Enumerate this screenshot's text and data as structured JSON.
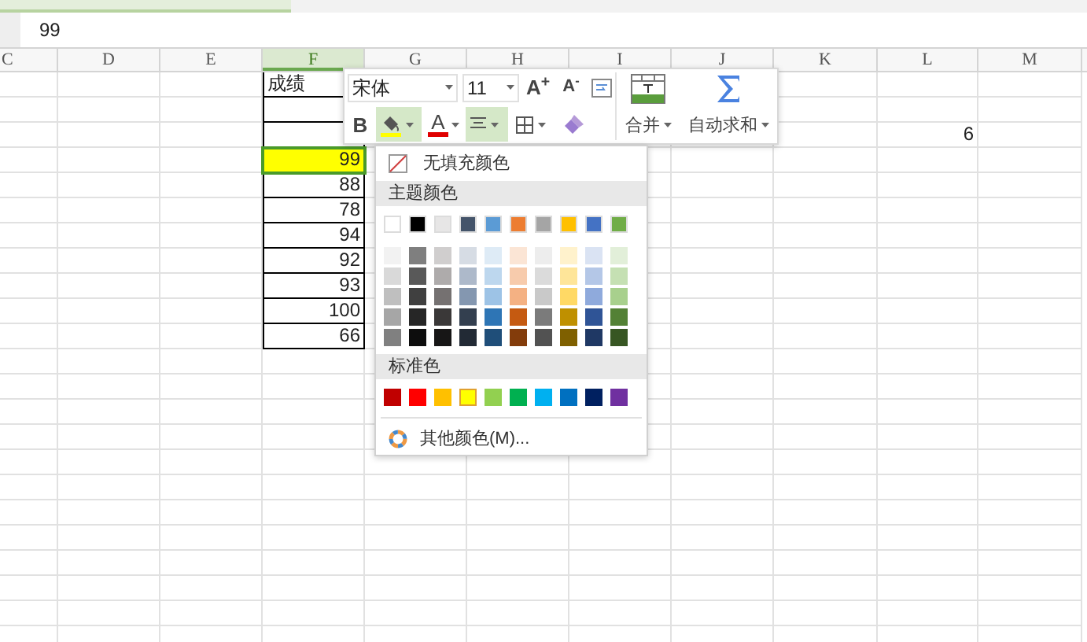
{
  "formula_bar": {
    "value": "99"
  },
  "columns": [
    {
      "label": "C",
      "selected": false
    },
    {
      "label": "D",
      "selected": false
    },
    {
      "label": "E",
      "selected": false
    },
    {
      "label": "F",
      "selected": true,
      "cells": [
        {
          "kind": "text",
          "text": "成绩"
        },
        {
          "kind": "number"
        },
        {
          "kind": "number"
        },
        {
          "kind": "number",
          "text": "99",
          "selected": true,
          "color": "#ffff00"
        },
        {
          "kind": "number",
          "text": "88"
        },
        {
          "kind": "number",
          "text": "78"
        },
        {
          "kind": "number",
          "text": "94"
        },
        {
          "kind": "number",
          "text": "92"
        },
        {
          "kind": "number",
          "text": "93"
        },
        {
          "kind": "number",
          "text": "100"
        },
        {
          "kind": "number",
          "text": "66"
        }
      ]
    },
    {
      "label": "G",
      "selected": false
    },
    {
      "label": "H",
      "selected": false
    },
    {
      "label": "I",
      "selected": false
    },
    {
      "label": "J",
      "selected": false
    },
    {
      "label": "K",
      "selected": false
    },
    {
      "label": "L",
      "selected": false,
      "cells": [
        {},
        {},
        {
          "kind": "number",
          "text": "6"
        }
      ]
    },
    {
      "label": "M",
      "selected": false
    }
  ],
  "toolbar": {
    "font": "宋体",
    "size": "11",
    "grow_font": "A$^{+}$",
    "shrink_font": "A$^{-}$",
    "bold": "B",
    "font_color": "A",
    "fill_selected": true,
    "align_selected": true,
    "merge": "合并",
    "autosum": "自动求和"
  },
  "fill_menu": {
    "no_fill": "无填充颜色",
    "theme_title": "主题颜色",
    "theme": [
      {
        "color": "#ffffff"
      },
      {
        "color": "#000000"
      },
      {
        "color": "#e7e6e6"
      },
      {
        "color": "#44546a"
      },
      {
        "color": "#5b9bd5"
      },
      {
        "color": "#ed7d31"
      },
      {
        "color": "#a5a5a5"
      },
      {
        "color": "#ffc000"
      },
      {
        "color": "#4472c4"
      },
      {
        "color": "#70ad47"
      }
    ],
    "shades": [
      {
        "swatches": [
          {
            "color": "#f2f2f2"
          },
          {
            "color": "#7f7f7f"
          },
          {
            "color": "#d0cece"
          },
          {
            "color": "#d6dce4"
          },
          {
            "color": "#deebf6"
          },
          {
            "color": "#fbe5d5"
          },
          {
            "color": "#ededed"
          },
          {
            "color": "#fff2cc"
          },
          {
            "color": "#dae3f3"
          },
          {
            "color": "#e2efd9"
          }
        ]
      },
      {
        "swatches": [
          {
            "color": "#d9d9d9"
          },
          {
            "color": "#595959"
          },
          {
            "color": "#aeabab"
          },
          {
            "color": "#adb9ca"
          },
          {
            "color": "#bdd7ee"
          },
          {
            "color": "#f7cbac"
          },
          {
            "color": "#dbdbdb"
          },
          {
            "color": "#fee599"
          },
          {
            "color": "#b4c7e7"
          },
          {
            "color": "#c5e0b3"
          }
        ]
      },
      {
        "swatches": [
          {
            "color": "#bfbfbf"
          },
          {
            "color": "#404040"
          },
          {
            "color": "#757171"
          },
          {
            "color": "#8497b0"
          },
          {
            "color": "#9dc3e6"
          },
          {
            "color": "#f4b183"
          },
          {
            "color": "#c9c9c9"
          },
          {
            "color": "#ffd965"
          },
          {
            "color": "#8faadc"
          },
          {
            "color": "#a8d08d"
          }
        ]
      },
      {
        "swatches": [
          {
            "color": "#a6a6a6"
          },
          {
            "color": "#262626"
          },
          {
            "color": "#3a3838"
          },
          {
            "color": "#333f4f"
          },
          {
            "color": "#2e75b5"
          },
          {
            "color": "#c55a11"
          },
          {
            "color": "#7b7b7b"
          },
          {
            "color": "#bf9000"
          },
          {
            "color": "#2f5496"
          },
          {
            "color": "#538135"
          }
        ]
      },
      {
        "swatches": [
          {
            "color": "#808080"
          },
          {
            "color": "#0d0d0d"
          },
          {
            "color": "#171616"
          },
          {
            "color": "#222a35"
          },
          {
            "color": "#1f4e79"
          },
          {
            "color": "#833c0b"
          },
          {
            "color": "#525252"
          },
          {
            "color": "#7f6000"
          },
          {
            "color": "#1f3864"
          },
          {
            "color": "#375623"
          }
        ]
      }
    ],
    "standard_title": "标准色",
    "standard": [
      {
        "color": "#c00000",
        "selected": false
      },
      {
        "color": "#ff0000",
        "selected": false
      },
      {
        "color": "#ffc000",
        "selected": false
      },
      {
        "color": "#ffff00",
        "selected": true
      },
      {
        "color": "#92d050",
        "selected": false
      },
      {
        "color": "#00b050",
        "selected": false
      },
      {
        "color": "#00b0f0",
        "selected": false
      },
      {
        "color": "#0070c0",
        "selected": false
      },
      {
        "color": "#002060",
        "selected": false
      },
      {
        "color": "#7030a0",
        "selected": false
      }
    ],
    "more": "其他颜色(M)..."
  }
}
